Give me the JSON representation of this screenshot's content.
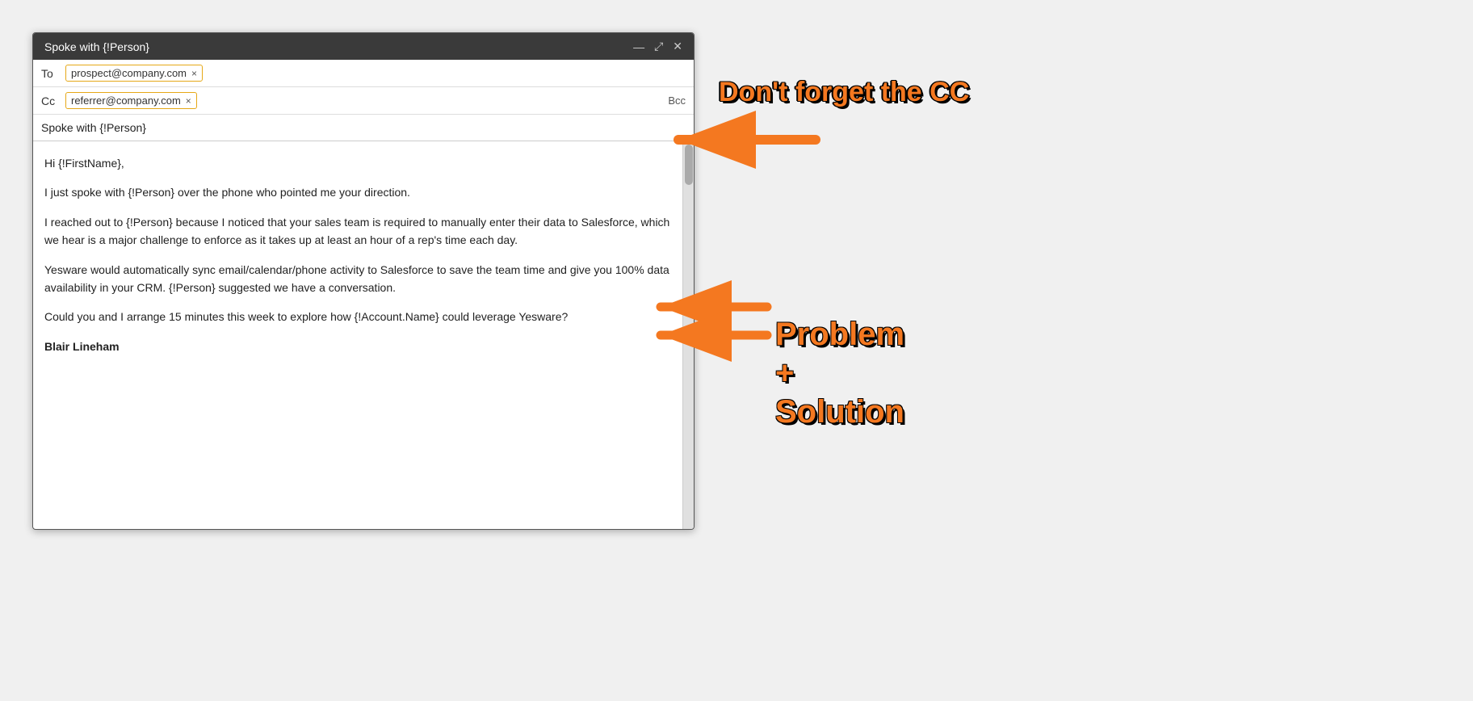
{
  "window": {
    "title": "Spoke with {!Person}",
    "controls": {
      "minimize": "—",
      "maximize": "⤢",
      "close": "✕"
    }
  },
  "to_field": {
    "label": "To",
    "recipient": "prospect@company.com"
  },
  "cc_field": {
    "label": "Cc",
    "recipient": "referrer@company.com",
    "bcc_label": "Bcc"
  },
  "subject": "Spoke with {!Person}",
  "body": {
    "greeting": "Hi {!FirstName},",
    "paragraph1": "I just spoke with {!Person} over the phone who pointed me your direction.",
    "paragraph2": "I reached out to {!Person} because I noticed that your sales team is required to manually enter their data to Salesforce, which we hear is a major challenge to enforce as it takes up at least an hour of a rep's time each day.",
    "paragraph3": "Yesware would automatically sync email/calendar/phone activity to Salesforce to save the team time and give you 100% data availability in your CRM. {!Person} suggested we have a conversation.",
    "paragraph4": "Could you and I arrange 15 minutes this week to explore how {!Account.Name} could leverage Yesware?",
    "signature": "Blair Lineham"
  },
  "annotations": {
    "cc_label": "Don't forget the CC",
    "problem_label": "Problem\n+\nSolution"
  }
}
